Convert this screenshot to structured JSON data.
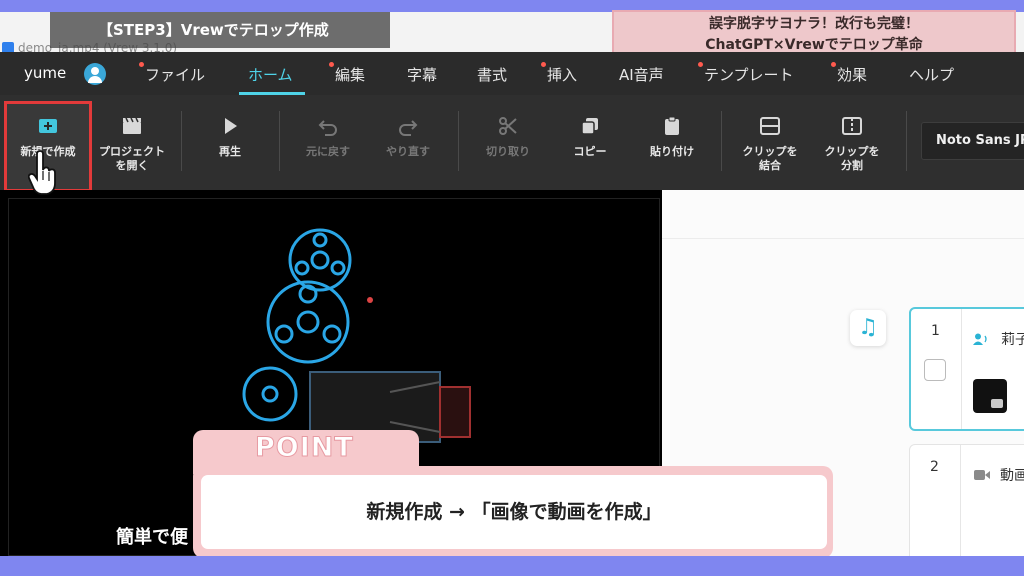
{
  "window": {
    "doc_title": "demo_ja.mp4 (Vrew 3.1.0)"
  },
  "overlay": {
    "step_banner": "【STEP3】Vrewでテロップ作成",
    "headline_line1": "誤字脱字サヨナラ！改行も完璧！",
    "headline_line2": "ChatGPT×Vrewでテロップ革命",
    "point_label": "POINT",
    "point_text": "新規作成 → 「画像で動画を作成」"
  },
  "menubar": {
    "user_name": "yume",
    "items": [
      {
        "label": "ファイル",
        "dot": true
      },
      {
        "label": "ホーム",
        "active": true
      },
      {
        "label": "編集",
        "dot": true
      },
      {
        "label": "字幕"
      },
      {
        "label": "書式"
      },
      {
        "label": "挿入",
        "dot": true
      },
      {
        "label": "AI音声"
      },
      {
        "label": "テンプレート",
        "dot": true
      },
      {
        "label": "効果",
        "dot": true
      },
      {
        "label": "ヘルプ"
      }
    ]
  },
  "toolbar": {
    "new_project": "新規で作成",
    "open_project_1": "プロジェクト",
    "open_project_2": "を開く",
    "play": "再生",
    "undo": "元に戻す",
    "redo": "やり直す",
    "cut": "切り取り",
    "copy": "コピー",
    "paste": "貼り付け",
    "merge_1": "クリップを",
    "merge_2": "結合",
    "split_1": "クリップを",
    "split_2": "分割",
    "font": "Noto Sans JP"
  },
  "preview": {
    "subtitle": "簡単で便"
  },
  "clips": [
    {
      "number": "1",
      "speaker": "莉子"
    },
    {
      "number": "2",
      "label": "動画"
    }
  ],
  "colors": {
    "accent": "#4fd3e8",
    "highlight": "#e23a3a",
    "point_pink": "#f6c9cc",
    "frame": "#7f86f0"
  }
}
